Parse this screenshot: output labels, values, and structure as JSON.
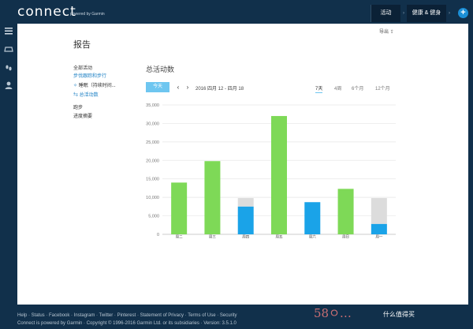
{
  "header": {
    "logo": "connect",
    "logo_sub": "powered by Garmin",
    "btn1": "活动",
    "btn2": "健康 & 健身",
    "plus": "+",
    "arrow": "›"
  },
  "nav_icons": [
    "menu-icon",
    "inbox-icon",
    "steps-icon",
    "user-icon"
  ],
  "page": {
    "title": "报告",
    "export": "导出 ⇪"
  },
  "sidebar": {
    "group1_title": "全部活动",
    "items": [
      "步伐跟踪和步行",
      "睡眠（持续时间...",
      "总活动数"
    ],
    "group2_title": "跑步",
    "group2_items": [
      "进度摘要"
    ]
  },
  "report": {
    "title": "总活动数",
    "today": "今天",
    "prev": "‹",
    "next": "›",
    "date_range": "2016 四月 12 - 四月 18",
    "periods": [
      "7天",
      "4周",
      "6个月",
      "12个月"
    ]
  },
  "chart_data": {
    "type": "bar",
    "categories": [
      "周二",
      "周三",
      "周四",
      "周五",
      "周六",
      "周日",
      "周一"
    ],
    "series": [
      {
        "values": [
          14000,
          19800,
          7500,
          32000,
          8700,
          12300,
          2800
        ],
        "color_key": "bar_color"
      },
      {
        "values": [
          0,
          0,
          2300,
          0,
          0,
          0,
          7000
        ],
        "color_key": "remain_color"
      }
    ],
    "bar_color": [
      "#7ed957",
      "#7ed957",
      "#1aa3e8",
      "#7ed957",
      "#1aa3e8",
      "#7ed957",
      "#1aa3e8"
    ],
    "remain_color": "#dcdcdc",
    "yticks": [
      "0",
      "5,000",
      "10,000",
      "15,000",
      "20,000",
      "25,000",
      "30,000",
      "35,000"
    ],
    "ylim": [
      0,
      35000
    ],
    "grid": true
  },
  "footer": {
    "links": "Help · Status · Facebook · Instagram · Twitter · Pinterest · Statement of Privacy · Terms of Use · Security",
    "copyright": "Connect is powered by Garmin · Copyright © 1996-2016 Garmin Ltd. or its subsidiaries · Version: 3.5.1.0",
    "watermark": "58ㅇ…",
    "watermark2": "什么值得买"
  }
}
